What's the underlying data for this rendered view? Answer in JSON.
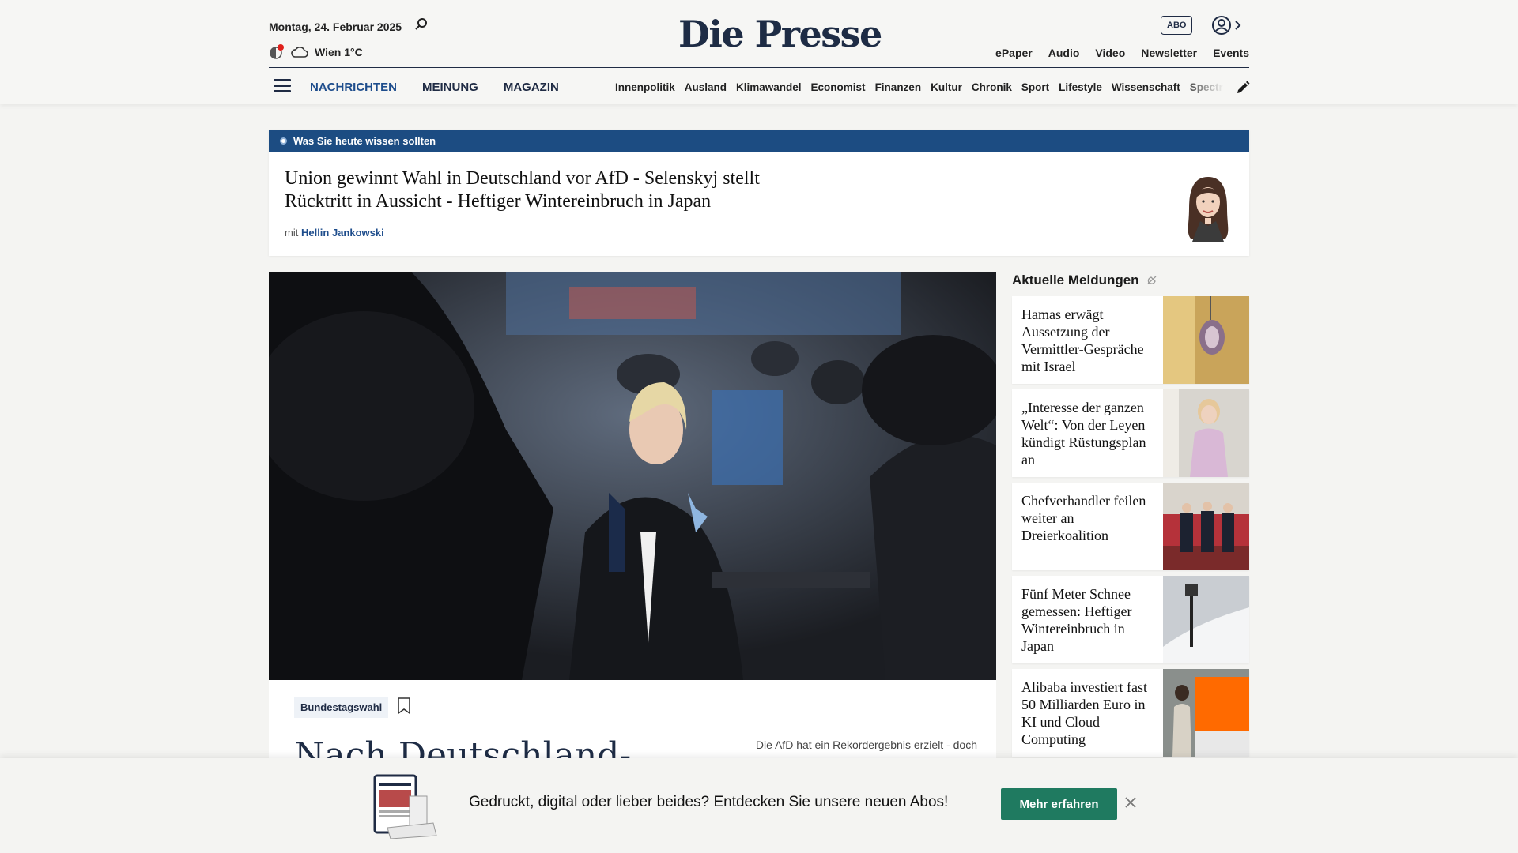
{
  "header": {
    "date": "Montag, 24. Februar 2025",
    "weather": "Wien 1°C",
    "logo": "Die Presse",
    "abo": "ABO",
    "top_links": [
      "ePaper",
      "Audio",
      "Video",
      "Newsletter",
      "Events"
    ],
    "main_nav": [
      "NACHRICHTEN",
      "MEINUNG",
      "MAGAZIN"
    ],
    "sub_nav": [
      "Innenpolitik",
      "Ausland",
      "Klimawandel",
      "Economist",
      "Finanzen",
      "Kultur",
      "Chronik",
      "Sport",
      "Lifestyle",
      "Wissenschaft",
      "Spectrum"
    ]
  },
  "briefing": {
    "label": "Was Sie heute wissen sollten",
    "title": "Union gewinnt Wahl in Deutschland vor AfD - Selenskyj stellt Rücktritt in Aussicht - Heftiger Wintereinbruch in Japan",
    "by_prefix": "mit",
    "author": "Hellin Jankowski"
  },
  "lead_article": {
    "tag": "Bundestagswahl",
    "headline": "Nach Deutschland-",
    "teaser": "Die AfD hat ein Rekordergebnis erzielt - doch"
  },
  "aside": {
    "title": "Aktuelle Meldungen",
    "items": [
      {
        "title": "Hamas erwägt Aussetzung der Vermittler-Gespräche mit Israel"
      },
      {
        "title": "„Interesse der ganzen Welt“: Von der Leyen kündigt Rüstungsplan an"
      },
      {
        "title": "Chefverhandler feilen weiter an Dreierkoalition"
      },
      {
        "title": "Fünf Meter Schnee gemessen: Heftiger Wintereinbruch in Japan"
      },
      {
        "title": "Alibaba investiert fast 50 Milliarden Euro in KI und Cloud Computing"
      }
    ]
  },
  "banner": {
    "text": "Gedruckt, digital oder lieber beides? Entdecken Sie unsere neuen Abos!",
    "cta": "Mehr erfahren"
  },
  "colors": {
    "brand_navy": "#1f2b44",
    "accent_blue": "#1c4c82",
    "cta_green": "#1f7a60"
  }
}
